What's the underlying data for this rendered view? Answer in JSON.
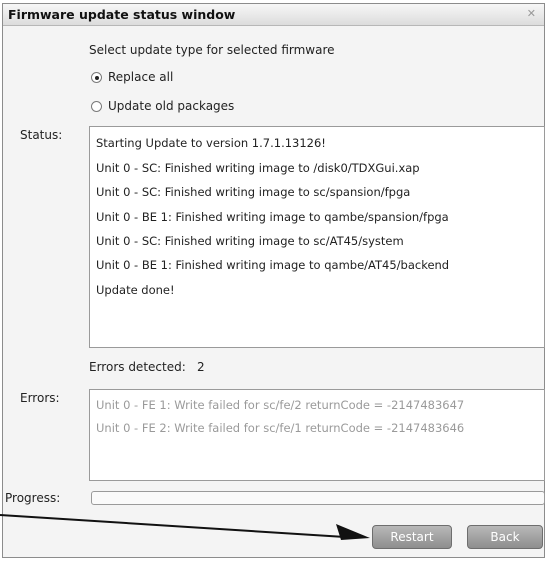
{
  "window": {
    "title": "Firmware update status window",
    "close_glyph": "✕"
  },
  "update_type": {
    "prompt": "Select update type for selected firmware",
    "options": [
      {
        "label": "Replace all",
        "selected": true
      },
      {
        "label": "Update old packages",
        "selected": false
      }
    ]
  },
  "status": {
    "label": "Status:",
    "lines": [
      "Starting Update to version 1.7.1.13126!",
      "Unit 0 - SC: Finished writing image to /disk0/TDXGui.xap",
      "Unit 0 - SC: Finished writing image to sc/spansion/fpga",
      "Unit 0 - BE 1: Finished writing image to qambe/spansion/fpga",
      "Unit 0 - SC: Finished writing image to sc/AT45/system",
      "Unit 0 - BE 1: Finished writing image to qambe/AT45/backend",
      "Update done!"
    ]
  },
  "errors_detected": {
    "label": "Errors detected:",
    "count": "2"
  },
  "errors": {
    "label": "Errors:",
    "lines": [
      "Unit 0 - FE 1: Write failed for sc/fe/2 returnCode = -2147483647",
      "Unit 0 - FE 2: Write failed for sc/fe/1 returnCode = -2147483646"
    ]
  },
  "progress": {
    "label": "Progress:",
    "value": 0
  },
  "buttons": {
    "restart": "Restart",
    "back": "Back"
  },
  "icons": {
    "close": "close-icon",
    "annotation": "arrow-icon"
  }
}
